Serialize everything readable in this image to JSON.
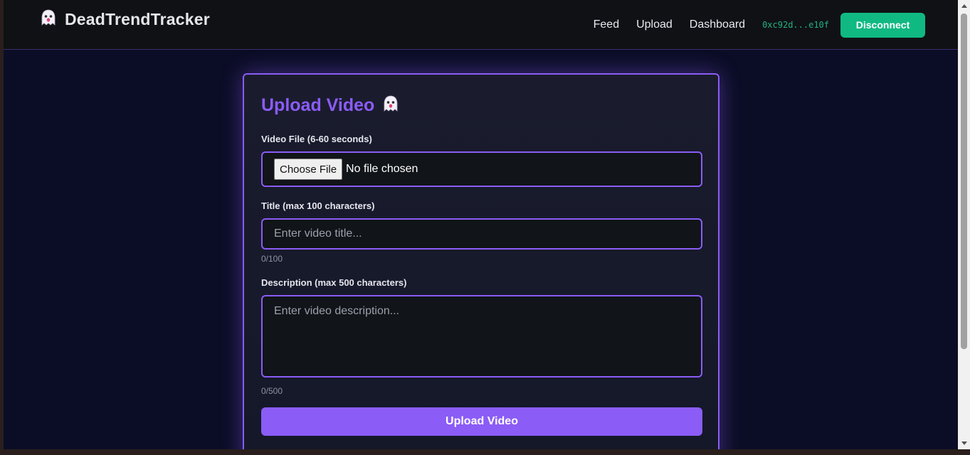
{
  "brand": {
    "name": "DeadTrendTracker",
    "icon": "ghost-icon"
  },
  "nav": {
    "links": [
      "Feed",
      "Upload",
      "Dashboard"
    ],
    "wallet": "0xc92d...e10f",
    "disconnect_label": "Disconnect"
  },
  "form": {
    "title": "Upload Video",
    "title_icon": "ghost-icon",
    "file_label": "Video File (6-60 seconds)",
    "file_button": "Choose File",
    "file_status": "No file chosen",
    "title_label": "Title (max 100 characters)",
    "title_placeholder": "Enter video title...",
    "title_value": "",
    "title_counter": "0/100",
    "description_label": "Description (max 500 characters)",
    "description_placeholder": "Enter video description...",
    "description_value": "",
    "description_counter": "0/500",
    "submit_label": "Upload Video"
  },
  "colors": {
    "accent": "#8b5cf6",
    "success": "#10b981",
    "background": "#0b0d26",
    "navbar": "#0f1115"
  }
}
